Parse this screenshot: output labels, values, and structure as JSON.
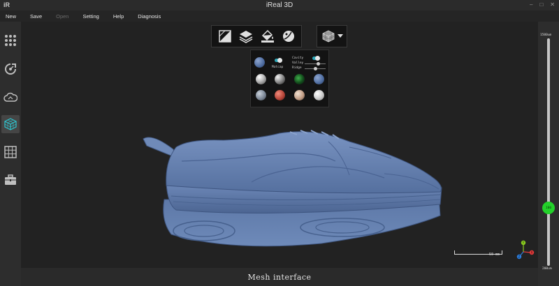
{
  "window": {
    "logo": "iR",
    "title": "iReal 3D",
    "controls": [
      "–",
      "□",
      "✕"
    ]
  },
  "menu": [
    {
      "label": "New",
      "enabled": true
    },
    {
      "label": "Save",
      "enabled": true
    },
    {
      "label": "Open",
      "enabled": false
    },
    {
      "label": "Setting",
      "enabled": true
    },
    {
      "label": "Help",
      "enabled": true
    },
    {
      "label": "Diagnosis",
      "enabled": true
    }
  ],
  "left_toolbar": {
    "items": [
      {
        "icon": "grid-dots-icon",
        "active": false
      },
      {
        "icon": "scan-rotate-icon",
        "active": false
      },
      {
        "icon": "cloud-icon",
        "active": false
      },
      {
        "icon": "mesh-cube-icon",
        "active": true
      },
      {
        "icon": "table-grid-icon",
        "active": false
      },
      {
        "icon": "toolbox-icon",
        "active": false
      }
    ]
  },
  "top_tools": {
    "items": [
      "texture-square-icon",
      "layers-icon",
      "paint-bucket-icon",
      "sphere-material-icon"
    ]
  },
  "view_tools": {
    "icon": "view-cube-icon",
    "dropdown": "chevron-down-icon"
  },
  "material_panel": {
    "matcap_label": "Matcap",
    "cavity_label": "Cavity",
    "valley_label": "Valley",
    "ridge_label": "Ridge",
    "matcap_enabled": true,
    "cavity_enabled": true,
    "valley_level": 0.6,
    "ridge_level": 0.45,
    "selected_color": "#5a7bb3",
    "spheres": [
      [
        "#bdbdbd",
        "#9a9a9a",
        "#1e6a2a",
        "#5474a8"
      ],
      [
        "#8f9aa8",
        "#b8463a",
        "#c9a892",
        "#d9d9d9"
      ]
    ]
  },
  "scale_bar": {
    "label": "50 mm"
  },
  "axis": {
    "x": "X",
    "y": "Y",
    "z": "Z",
    "x_color": "#e23b3b",
    "y_color": "#8ccf1f",
    "z_color": "#2d7fe0"
  },
  "bottom": {
    "caption": "Mesh interface"
  },
  "right_slider": {
    "max_label": "1500um",
    "min_label": "200um",
    "value": "100",
    "level": 0.25,
    "handle_color": "#23d12a"
  },
  "model": {
    "color": "#6682b3"
  }
}
